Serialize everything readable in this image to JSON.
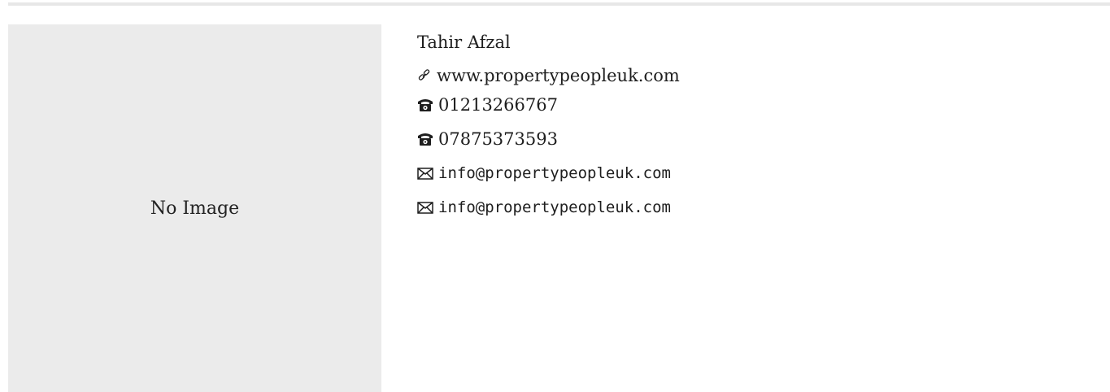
{
  "image_placeholder": {
    "label": "No Image"
  },
  "contact": {
    "name": "Tahir Afzal",
    "website": "www.propertypeopleuk.com",
    "phones": [
      "01213266767",
      "07875373593"
    ],
    "emails": [
      "info@propertypeopleuk.com",
      "info@propertypeopleuk.com"
    ]
  },
  "icons": {
    "website": "link-icon",
    "phone": "phone-icon",
    "email": "envelope-icon"
  },
  "colors": {
    "text": "#1e1e1e",
    "placeholder_bg": "#ebebeb",
    "divider": "#e7e7e7"
  }
}
